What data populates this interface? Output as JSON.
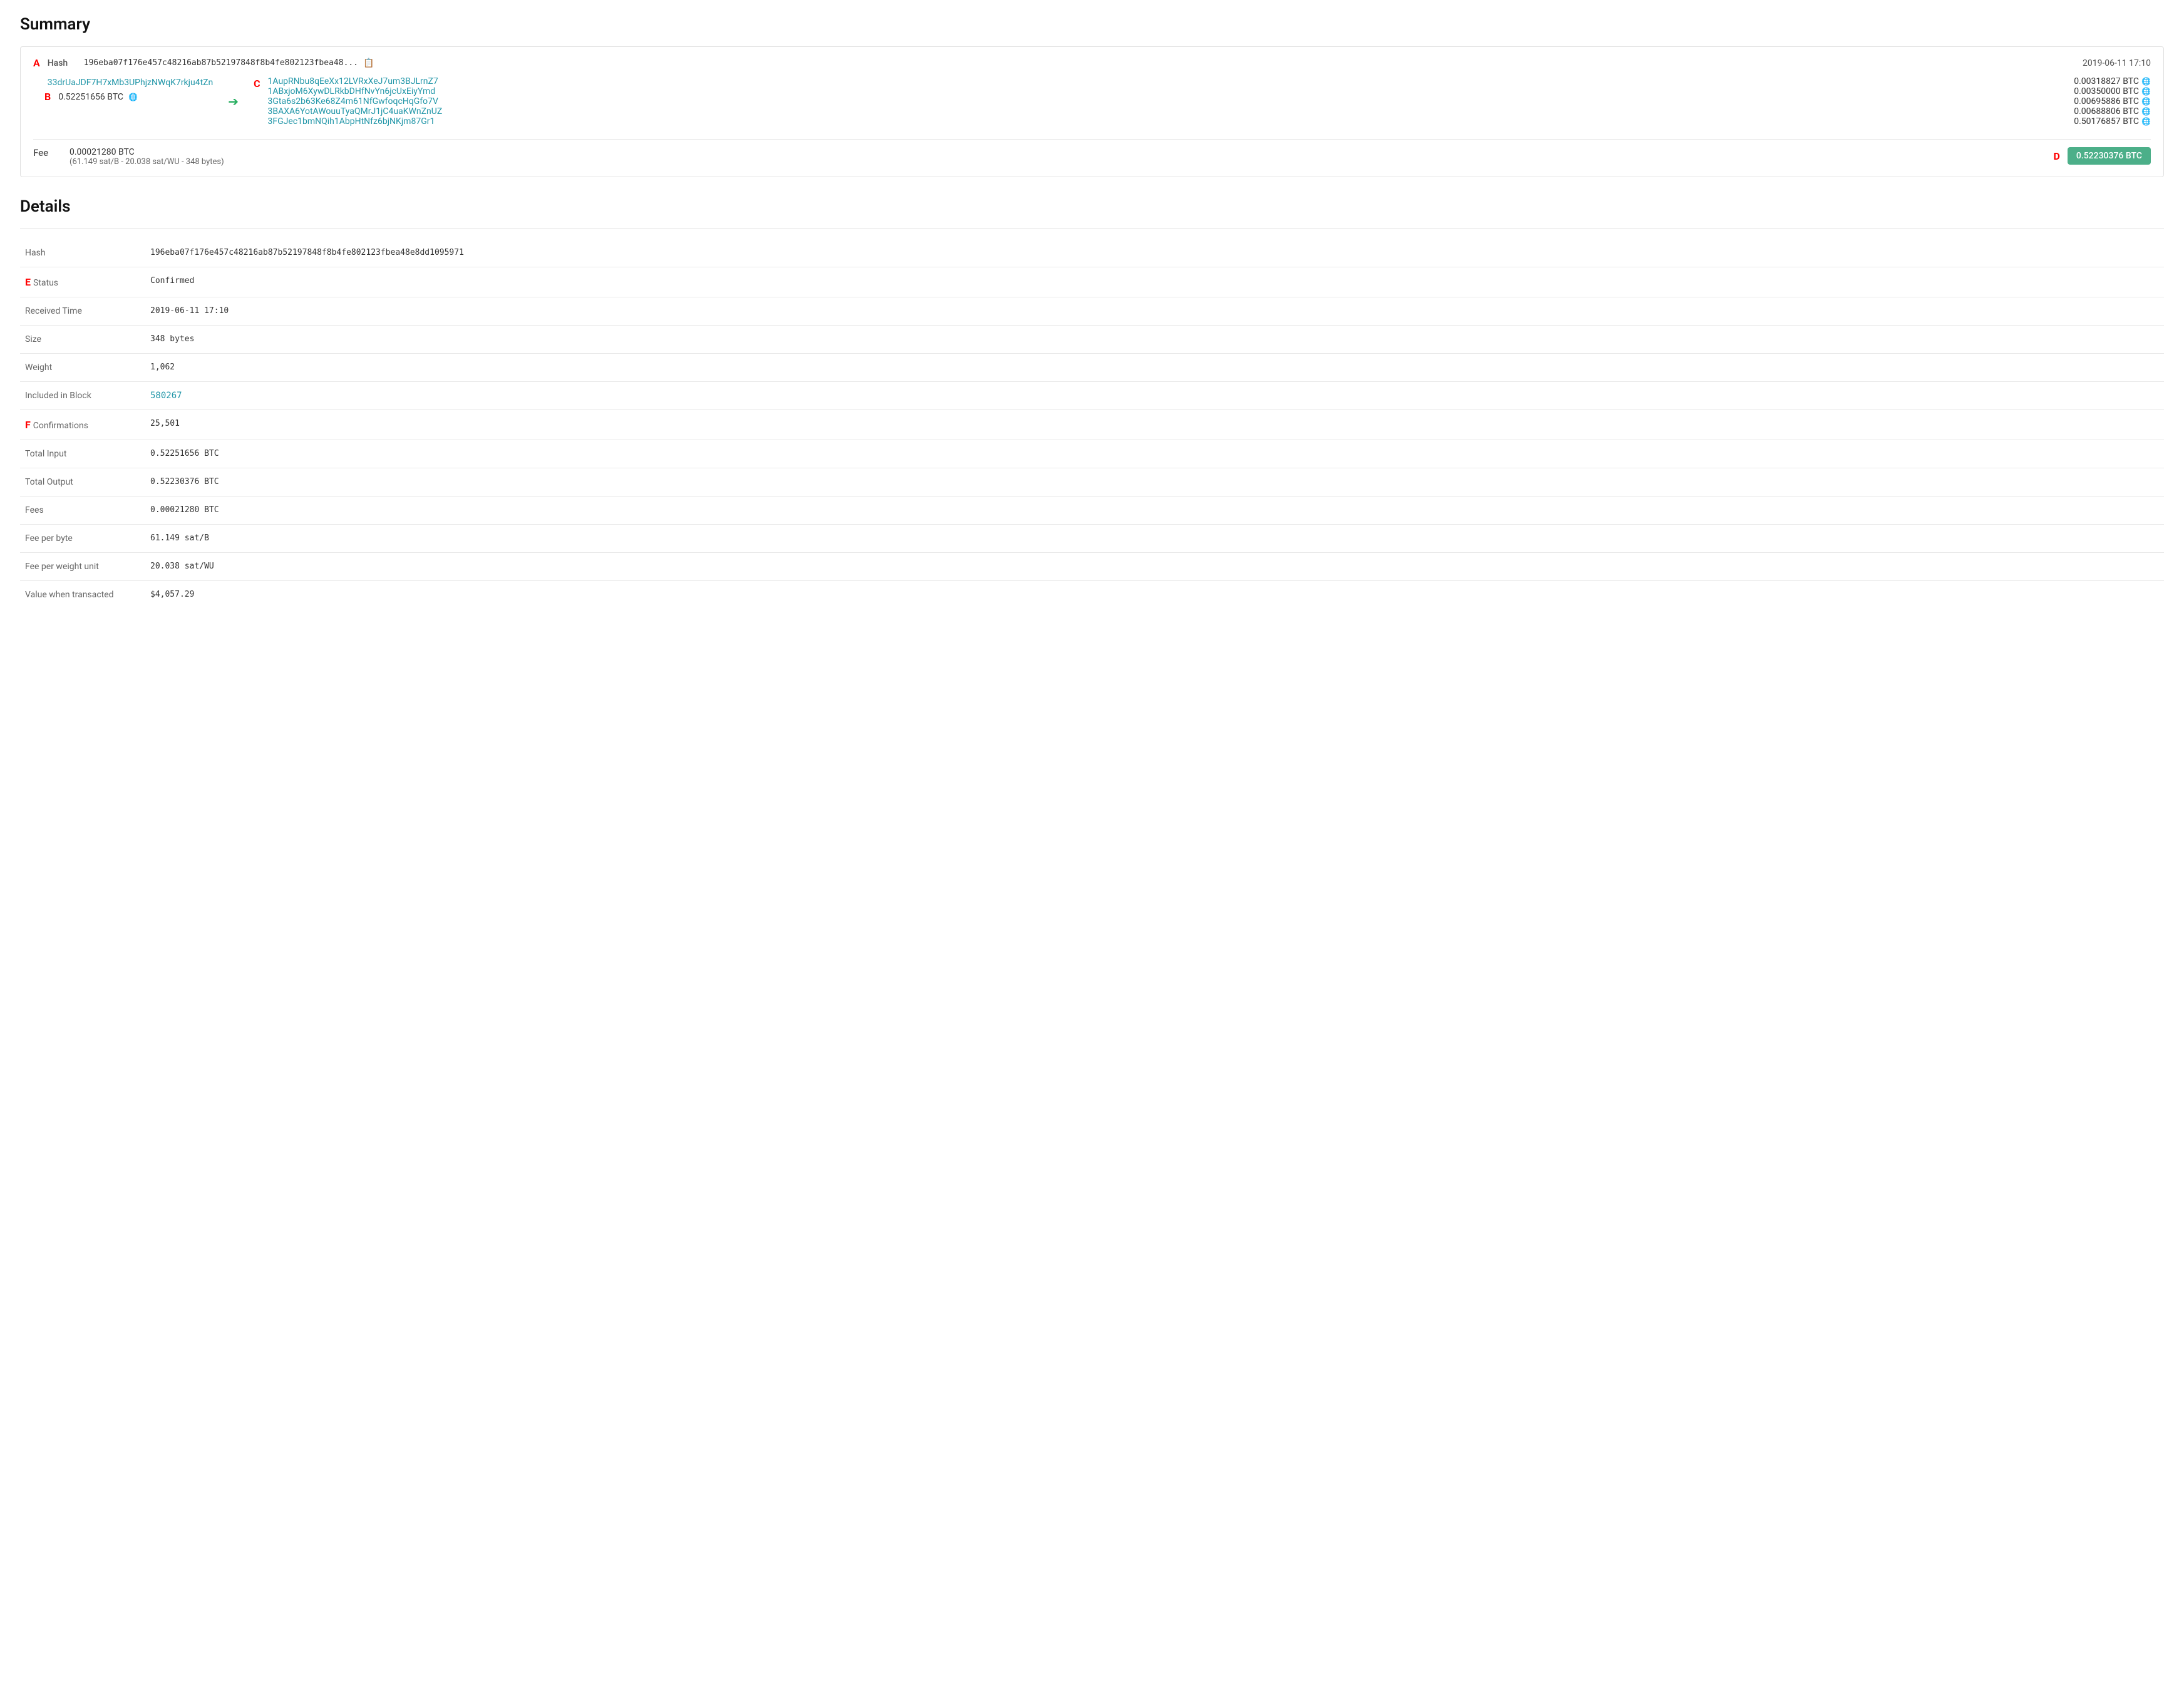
{
  "page": {
    "summary_title": "Summary",
    "details_title": "Details"
  },
  "summary": {
    "hash_label": "Hash",
    "hash_short": "196eba07f176e457c48216ab87b52197848f8b4fe802123fbea48...",
    "hash_full": "196eba07f176e457c48216ab87b52197848f8b4fe802123fbea48e8dd1095971",
    "date": "2019-06-11 17:10",
    "input_address": "33drUaJDF7H7xMb3UPhjzNWqK7rkju4tZn",
    "input_amount": "0.52251656 BTC",
    "outputs": [
      {
        "address": "1AupRNbu8qEeXx12LVRxXeJ7um3BJLrnZ7",
        "amount": "0.00318827 BTC"
      },
      {
        "address": "1ABxjoM6XywDLRkbDHfNvYn6jcUxEiyYmd",
        "amount": "0.00350000 BTC"
      },
      {
        "address": "3Gta6s2b63Ke68Z4m61NfGwfoqcHqGfo7V",
        "amount": "0.00695886 BTC"
      },
      {
        "address": "3BAXA6YotAWouuTyaQMrJ1jC4uaKWnZnUZ",
        "amount": "0.00688806 BTC"
      },
      {
        "address": "3FGJec1bmNQih1AbpHtNfz6bjNKjm87Gr1",
        "amount": "0.50176857 BTC"
      }
    ],
    "total_output": "0.52230376 BTC",
    "fee_label": "Fee",
    "fee_btc": "0.00021280 BTC",
    "fee_detail": "(61.149 sat/B - 20.038 sat/WU - 348 bytes)"
  },
  "details": {
    "rows": [
      {
        "label": "Hash",
        "value": "196eba07f176e457c48216ab87b52197848f8b4fe802123fbea48e8dd1095971",
        "type": "mono"
      },
      {
        "label": "Status",
        "value": "Confirmed",
        "type": "confirmed"
      },
      {
        "label": "Received Time",
        "value": "2019-06-11 17:10",
        "type": "normal"
      },
      {
        "label": "Size",
        "value": "348 bytes",
        "type": "normal"
      },
      {
        "label": "Weight",
        "value": "1,062",
        "type": "normal"
      },
      {
        "label": "Included in Block",
        "value": "580267",
        "type": "link"
      },
      {
        "label": "Confirmations",
        "value": "25,501",
        "type": "normal"
      },
      {
        "label": "Total Input",
        "value": "0.52251656 BTC",
        "type": "normal"
      },
      {
        "label": "Total Output",
        "value": "0.52230376 BTC",
        "type": "normal"
      },
      {
        "label": "Fees",
        "value": "0.00021280 BTC",
        "type": "normal"
      },
      {
        "label": "Fee per byte",
        "value": "61.149 sat/B",
        "type": "normal"
      },
      {
        "label": "Fee per weight unit",
        "value": "20.038 sat/WU",
        "type": "normal"
      },
      {
        "label": "Value when transacted",
        "value": "$4,057.29",
        "type": "normal"
      }
    ]
  },
  "labels": {
    "A": "A",
    "B": "B",
    "C": "C",
    "D": "D",
    "E": "E",
    "F": "F"
  }
}
